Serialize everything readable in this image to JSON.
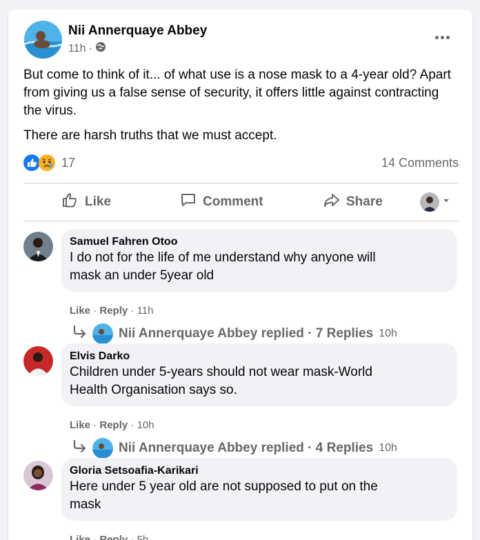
{
  "post": {
    "author": "Nii Annerquaye Abbey",
    "time": "11h",
    "privacy_sep": "·",
    "paragraphs": [
      "But come to think of it... of what use is a nose mask to a 4-year old? Apart from giving us a false sense of security, it offers little against contracting the virus.",
      "There are harsh truths that we must accept."
    ],
    "reaction_count": "17",
    "comments_count": "14 Comments"
  },
  "actions": {
    "like": "Like",
    "comment": "Comment",
    "share": "Share"
  },
  "comments": [
    {
      "name": "Samuel Fahren Otoo",
      "lines": [
        "I do not for the life of me understand why anyone will",
        "mask an under 5year old"
      ],
      "like": "Like",
      "reply": "Reply",
      "time": "11h",
      "replies_text": "Nii Annerquaye Abbey replied · 7 Replies",
      "replies_time": "10h"
    },
    {
      "name": "Elvis Darko",
      "lines": [
        "Children under 5-years should not wear mask-World",
        "Health Organisation says so."
      ],
      "like": "Like",
      "reply": "Reply",
      "time": "10h",
      "replies_text": "Nii Annerquaye Abbey replied · 4 Replies",
      "replies_time": "10h"
    },
    {
      "name": "Gloria Setsoafia-Karikari",
      "lines": [
        "Here under 5 year old are not supposed to put on the",
        "mask"
      ],
      "like": "Like",
      "reply": "Reply",
      "time": "5h"
    }
  ],
  "colors": {
    "accent": "#1877f2",
    "secondary": "#65676b",
    "bubble": "#f0f2f5"
  },
  "icons": [
    "globe-icon",
    "more-icon",
    "like-reaction-icon",
    "sad-reaction-icon",
    "like-icon",
    "comment-icon",
    "share-icon",
    "dropdown-icon",
    "reply-arrow-icon"
  ]
}
